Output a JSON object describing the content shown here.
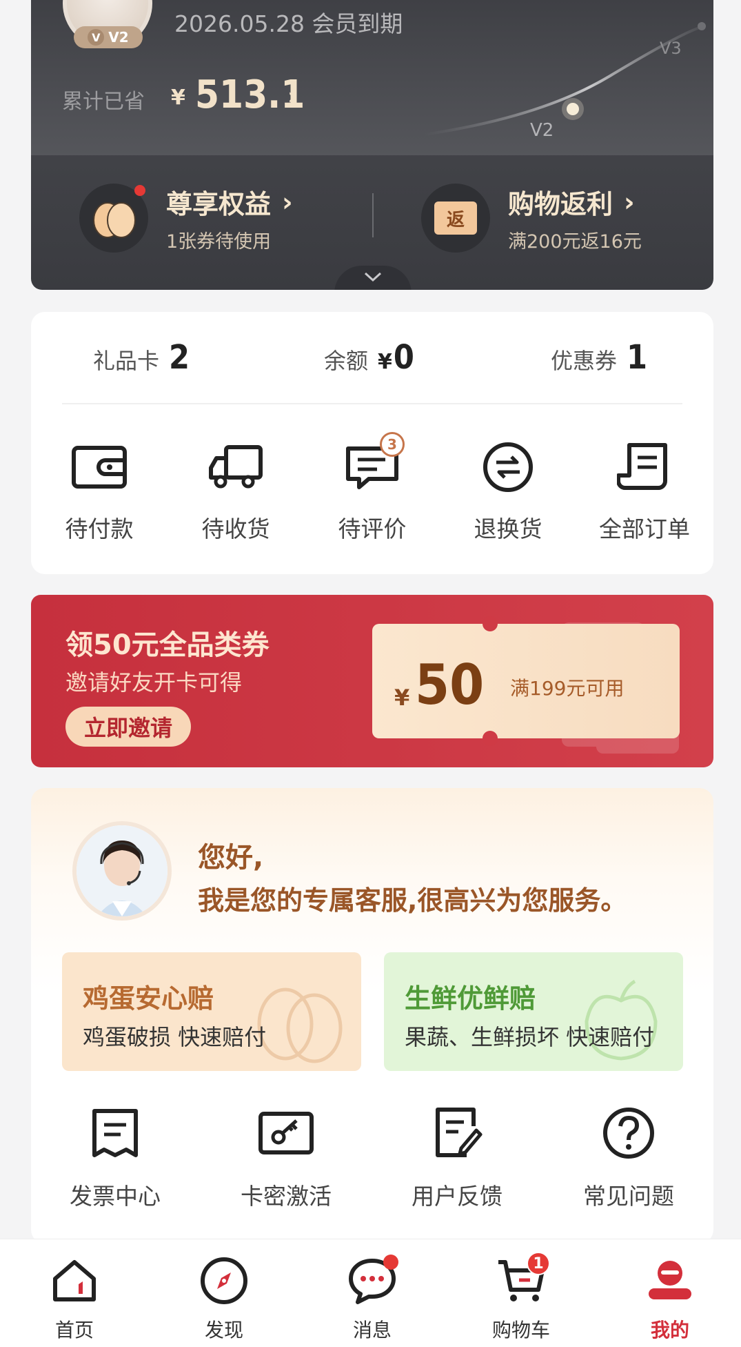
{
  "member": {
    "badge_level": "V2",
    "badge_prefix": "V",
    "expire_text": "2026.05.28 会员到期",
    "saved_label": "累计已省",
    "saved_currency": "¥",
    "saved_amount": "513.1",
    "saved_arrow": "›",
    "levels": {
      "current": "V2",
      "next": "V3"
    },
    "benefits": [
      {
        "title": "尊享权益",
        "subtitle": "1张券待使用",
        "arrow": "›",
        "has_dot": true,
        "icon": "egg-icon"
      },
      {
        "title": "购物返利",
        "subtitle": "满200元返16元",
        "arrow": "›",
        "icon_text": "返",
        "icon": "rebate-ticket-icon"
      }
    ]
  },
  "assets": {
    "gift_card": {
      "label": "礼品卡",
      "value": "2"
    },
    "balance": {
      "label": "余额",
      "currency": "¥",
      "value": "0"
    },
    "coupon": {
      "label": "优惠券",
      "value": "1"
    }
  },
  "orders": [
    {
      "label": "待付款",
      "icon": "wallet-icon"
    },
    {
      "label": "待收货",
      "icon": "truck-icon"
    },
    {
      "label": "待评价",
      "icon": "comment-icon",
      "badge": "3"
    },
    {
      "label": "退换货",
      "icon": "exchange-icon"
    },
    {
      "label": "全部订单",
      "icon": "order-list-icon"
    }
  ],
  "invite": {
    "title": "领50元全品类券",
    "subtitle": "邀请好友开卡可得",
    "button": "立即邀请",
    "coupon_currency": "¥",
    "coupon_amount": "50",
    "coupon_condition": "满199元可用"
  },
  "service": {
    "greeting_line1": "您好,",
    "greeting_line2": "我是您的专属客服,很高兴为您服务。",
    "promises": [
      {
        "title": "鸡蛋安心赔",
        "subtitle": "鸡蛋破损 快速赔付",
        "icon": "egg-watermark-icon"
      },
      {
        "title": "生鲜优鲜赔",
        "subtitle": "果蔬、生鲜损坏 快速赔付",
        "icon": "apple-watermark-icon"
      }
    ],
    "tools": [
      {
        "label": "发票中心",
        "icon": "invoice-icon"
      },
      {
        "label": "卡密激活",
        "icon": "key-card-icon"
      },
      {
        "label": "用户反馈",
        "icon": "feedback-icon"
      },
      {
        "label": "常见问题",
        "icon": "question-icon"
      }
    ]
  },
  "nav": [
    {
      "label": "首页",
      "icon": "home-icon"
    },
    {
      "label": "发现",
      "icon": "compass-icon"
    },
    {
      "label": "消息",
      "icon": "message-icon",
      "has_dot": true
    },
    {
      "label": "购物车",
      "icon": "cart-icon",
      "count": "1"
    },
    {
      "label": "我的",
      "icon": "profile-icon",
      "active": true
    }
  ],
  "colors": {
    "brand_red": "#d32f3b",
    "gold": "#f2e2c9",
    "card_dark": "#3f4045"
  }
}
